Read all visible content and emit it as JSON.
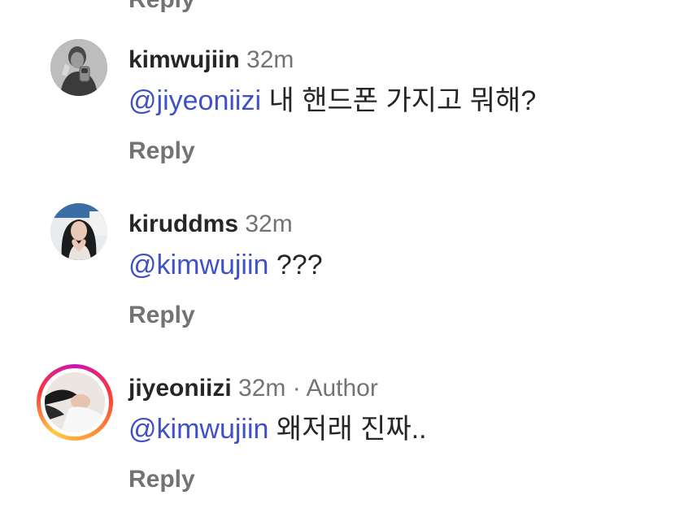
{
  "top_reply_label": "Reply",
  "comments": [
    {
      "username": "kimwujiin",
      "time": "32m",
      "mention": "@jiyeoniizi",
      "text": "내 핸드폰 가지고 뭐해?",
      "reply_label": "Reply",
      "avatar": "photo-avatar-man-holding-phone"
    },
    {
      "username": "kiruddms",
      "time": "32m",
      "mention": "@kimwujiin",
      "text": "???",
      "reply_label": "Reply",
      "avatar": "photo-avatar-woman-heart-hands"
    },
    {
      "username": "jiyeoniizi",
      "time": "32m",
      "separator": "·",
      "badge": "Author",
      "mention": "@kimwujiin",
      "text": "왜저래 진짜..",
      "reply_label": "Reply",
      "avatar": "photo-avatar-woman-lying-down",
      "story_ring": true
    }
  ],
  "colors": {
    "mention": "#3f51c8",
    "secondary_text": "#737373",
    "primary_text": "#262626",
    "story_ring": [
      "#c913b9",
      "#f9373f",
      "#fd8d32",
      "#ffc940"
    ]
  }
}
